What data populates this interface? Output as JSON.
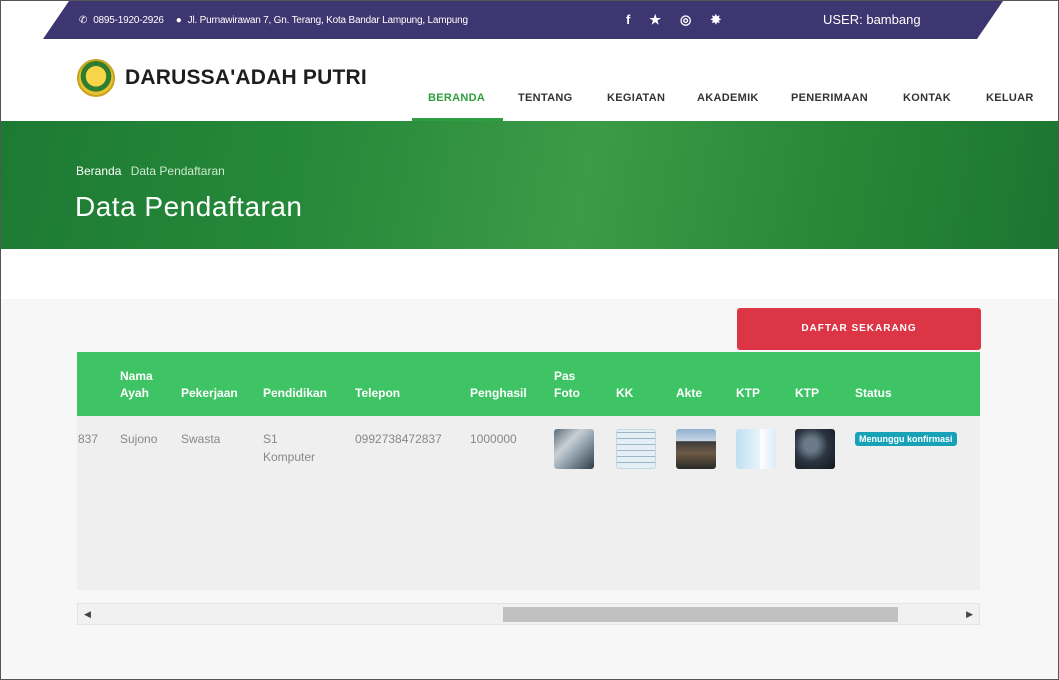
{
  "topbar": {
    "phone": "0895-1920-2926",
    "address": "Jl. Purnawirawan 7, Gn. Terang, Kota Bandar Lampung, Lampung",
    "social": [
      "f",
      "★",
      "◎",
      "✸"
    ],
    "user": "USER: bambang"
  },
  "nav": {
    "brand": "DARUSSA'ADAH PUTRI",
    "items": [
      "BERANDA",
      "TENTANG",
      "KEGIATAN",
      "AKADEMIK",
      "PENERIMAAN",
      "KONTAK",
      "KELUAR"
    ],
    "active": "BERANDA"
  },
  "hero": {
    "crumb_home": "Beranda",
    "crumb_current": "Data Pendaftaran",
    "title": "Data Pendaftaran"
  },
  "actions": {
    "daftar": "DAFTAR SEKARANG"
  },
  "table": {
    "headers": {
      "nama_ayah_1": "Nama",
      "nama_ayah_2": "Ayah",
      "pekerjaan": "Pekerjaan",
      "pendidikan": "Pendidikan",
      "telepon": "Telepon",
      "penghasil": "Penghasil",
      "pas_foto_1": "Pas",
      "pas_foto_2": "Foto",
      "kk": "KK",
      "akte": "Akte",
      "ktp1": "KTP",
      "ktp2": "KTP",
      "status": "Status"
    },
    "row": {
      "cut_value": "837",
      "nama_ayah": "Sujono",
      "pekerjaan": "Swasta",
      "pendidikan_1": "S1",
      "pendidikan_2": "Komputer",
      "telepon": "0992738472837",
      "penghasil": "1000000",
      "status": "Menunggu konfirmasi"
    }
  },
  "colors": {
    "topbar": "#3e3670",
    "accent_green": "#2e9e3e",
    "table_header": "#3ec465",
    "button_red": "#dc3545",
    "status_badge": "#17a2b8"
  }
}
